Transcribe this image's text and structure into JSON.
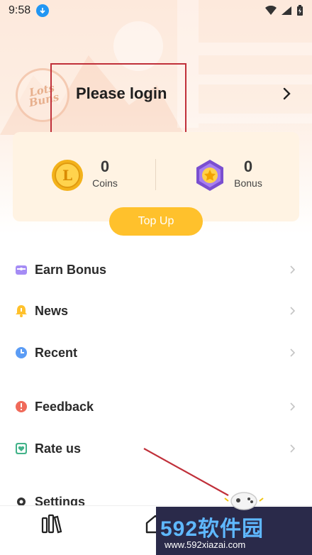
{
  "status_bar": {
    "time": "9:58"
  },
  "profile": {
    "title": "Please login",
    "avatar_text": "Lots\nBuns"
  },
  "wallet": {
    "coins": {
      "value": "0",
      "label": "Coins"
    },
    "bonus": {
      "value": "0",
      "label": "Bonus"
    },
    "topup_label": "Top Up"
  },
  "menu": {
    "items": [
      {
        "label": "Earn Bonus",
        "icon": "gift-icon",
        "color": "#a58cf5"
      },
      {
        "label": "News",
        "icon": "bell-icon",
        "color": "#ffc12c"
      },
      {
        "label": "Recent",
        "icon": "clock-icon",
        "color": "#5b9cf5"
      },
      {
        "label": "Feedback",
        "icon": "alert-icon",
        "color": "#f06a5a"
      },
      {
        "label": "Rate us",
        "icon": "heart-icon",
        "color": "#43b38a"
      },
      {
        "label": "Settings",
        "icon": "settings-icon",
        "color": "#333333"
      }
    ]
  },
  "watermark": {
    "big": "592软件园",
    "small": "www.592xiazai.com"
  },
  "colors": {
    "accent": "#ffc12c",
    "highlight": "#c0303a"
  }
}
